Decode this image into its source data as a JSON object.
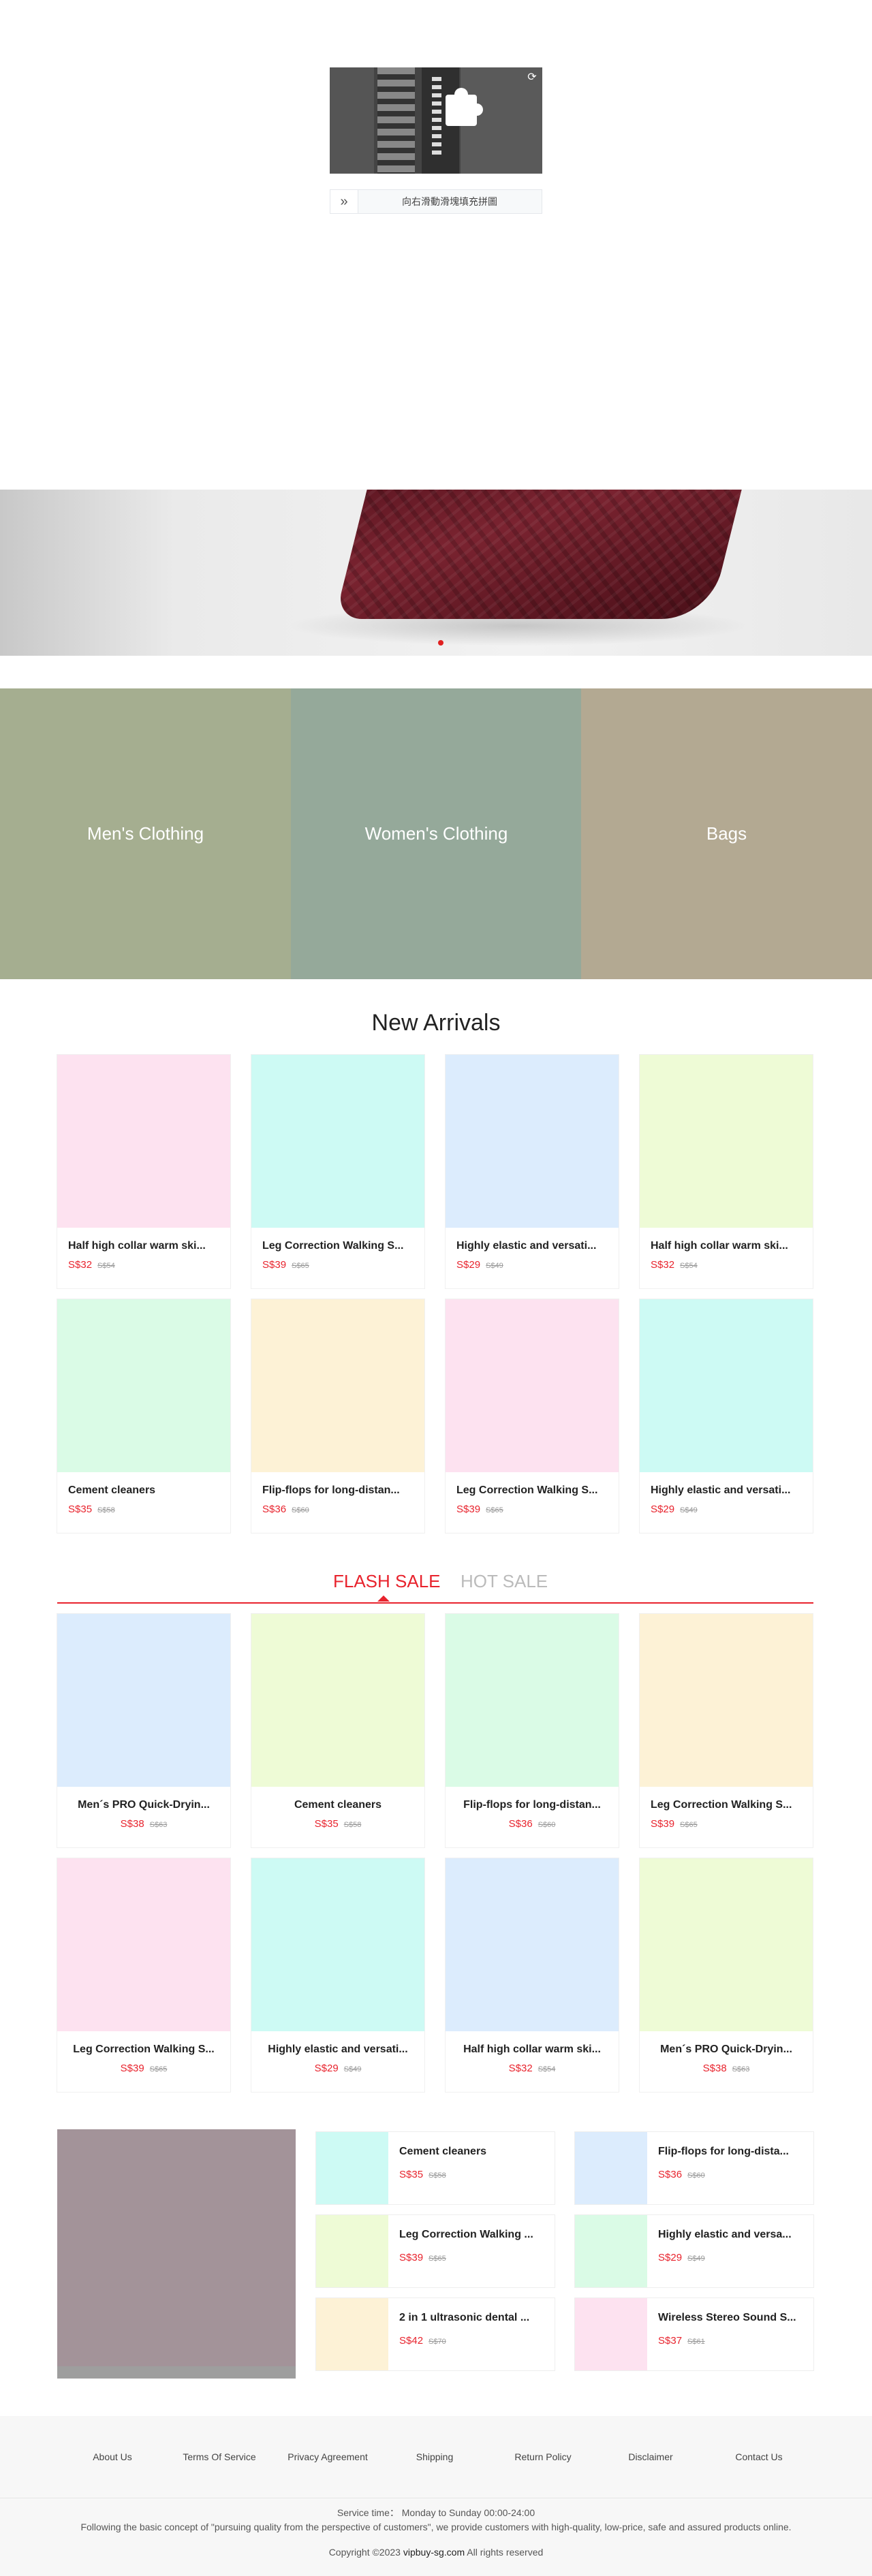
{
  "captcha": {
    "instruction": "向右滑動滑塊填充拼圖",
    "refresh_icon": "refresh-icon",
    "handle_icon": "double-chevron-right-icon"
  },
  "banner": {
    "active_slide": 1
  },
  "categories": [
    {
      "label": "Men's Clothing",
      "color": "#a5ae90"
    },
    {
      "label": "Women's Clothing",
      "color": "#95a99a"
    },
    {
      "label": "Bags",
      "color": "#b3a992"
    }
  ],
  "new_arrivals": {
    "title": "New Arrivals",
    "items": [
      {
        "name": "Half high collar warm ski...",
        "price": "S$32",
        "old_price": "S$54",
        "color": "#fde2f0"
      },
      {
        "name": "Leg Correction Walking S...",
        "price": "S$39",
        "old_price": "S$65",
        "color": "#cdfaf4"
      },
      {
        "name": "Highly elastic and versati...",
        "price": "S$29",
        "old_price": "S$49",
        "color": "#dcecfd"
      },
      {
        "name": "Half high collar warm ski...",
        "price": "S$32",
        "old_price": "S$54",
        "color": "#eefbd6"
      },
      {
        "name": "Cement cleaners",
        "price": "S$35",
        "old_price": "S$58",
        "color": "#dafbe6"
      },
      {
        "name": "Flip-flops for long-distan...",
        "price": "S$36",
        "old_price": "S$60",
        "color": "#fdf2d6"
      },
      {
        "name": "Leg Correction Walking S...",
        "price": "S$39",
        "old_price": "S$65",
        "color": "#fde2f0"
      },
      {
        "name": "Highly elastic and versati...",
        "price": "S$29",
        "old_price": "S$49",
        "color": "#cdfaf4"
      }
    ]
  },
  "sale_tabs": {
    "flash": "FLASH SALE",
    "hot": "HOT SALE",
    "active": "flash"
  },
  "flash_sale": {
    "items": [
      {
        "name": "Men´s PRO Quick-Dryin...",
        "price": "S$38",
        "old_price": "S$63",
        "color": "#dcecfd"
      },
      {
        "name": "Cement cleaners",
        "price": "S$35",
        "old_price": "S$58",
        "color": "#eefbd6"
      },
      {
        "name": "Flip-flops for long-distan...",
        "price": "S$36",
        "old_price": "S$60",
        "color": "#dafbe6"
      },
      {
        "name": "Leg Correction Walking S...",
        "price": "S$39",
        "old_price": "S$65",
        "color": "#fdf2d6"
      },
      {
        "name": "Leg Correction Walking S...",
        "price": "S$39",
        "old_price": "S$65",
        "color": "#fde2f0"
      },
      {
        "name": "Highly elastic and versati...",
        "price": "S$29",
        "old_price": "S$49",
        "color": "#cdfaf4"
      },
      {
        "name": "Half high collar warm ski...",
        "price": "S$32",
        "old_price": "S$54",
        "color": "#dcecfd"
      },
      {
        "name": "Men´s PRO Quick-Dryin...",
        "price": "S$38",
        "old_price": "S$63",
        "color": "#eefbd6"
      }
    ]
  },
  "promo": {
    "image_color": "#a39399",
    "items": [
      {
        "name": "Cement cleaners",
        "price": "S$35",
        "old_price": "S$58",
        "color": "#cdfaf4"
      },
      {
        "name": "Flip-flops for long-dista...",
        "price": "S$36",
        "old_price": "S$60",
        "color": "#dcecfd"
      },
      {
        "name": "Leg Correction Walking ...",
        "price": "S$39",
        "old_price": "S$65",
        "color": "#eefbd6"
      },
      {
        "name": "Highly elastic and versa...",
        "price": "S$29",
        "old_price": "S$49",
        "color": "#dafbe6"
      },
      {
        "name": "2 in 1 ultrasonic dental ...",
        "price": "S$42",
        "old_price": "S$70",
        "color": "#fdf2d6"
      },
      {
        "name": "Wireless Stereo Sound S...",
        "price": "S$37",
        "old_price": "S$61",
        "color": "#fde2f0"
      }
    ]
  },
  "footer": {
    "links": [
      "About Us",
      "Terms Of Service",
      "Privacy Agreement",
      "Shipping",
      "Return Policy",
      "Disclaimer",
      "Contact Us"
    ],
    "service_time": "Service time： Monday to Sunday 00:00-24:00",
    "description": "Following the basic concept of \"pursuing quality from the perspective of customers\", we provide customers with high-quality, low-price, safe and assured products online.",
    "copyright_prefix": "Copyright ©2023",
    "copyright_host": "vipbuy-sg.com",
    "copyright_suffix": "All rights reserved"
  },
  "accent_color": "#e8232d"
}
